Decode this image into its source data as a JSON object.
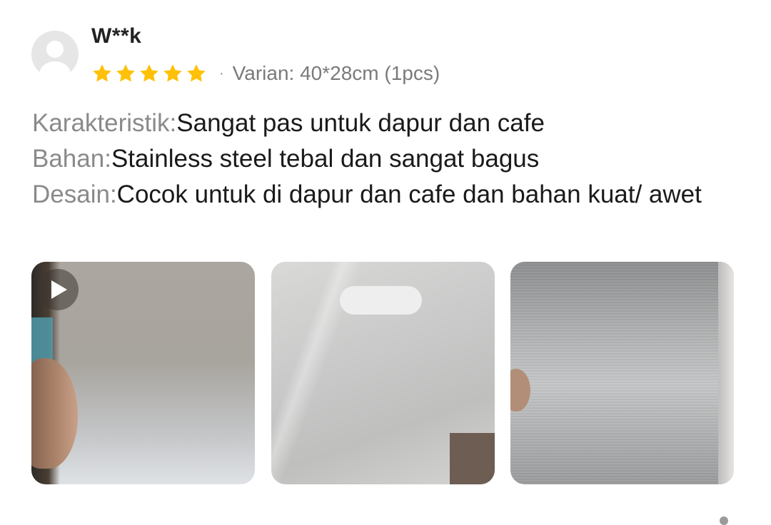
{
  "review": {
    "username": "W**k",
    "rating": 5,
    "rating_max": 5,
    "separator": "·",
    "variant": "Varian: 40*28cm (1pcs)",
    "star_color": "#FFC107",
    "attributes": [
      {
        "key": "Karakteristik:",
        "value": "Sangat pas untuk dapur dan cafe"
      },
      {
        "key": "Bahan:",
        "value": "Stainless steel tebal dan sangat bagus"
      },
      {
        "key": "Desain:",
        "value": "Cocok untuk di dapur dan cafe dan bahan kuat/ awet"
      }
    ],
    "media": [
      {
        "type": "video",
        "icon": "play-icon"
      },
      {
        "type": "image"
      },
      {
        "type": "image"
      }
    ]
  }
}
